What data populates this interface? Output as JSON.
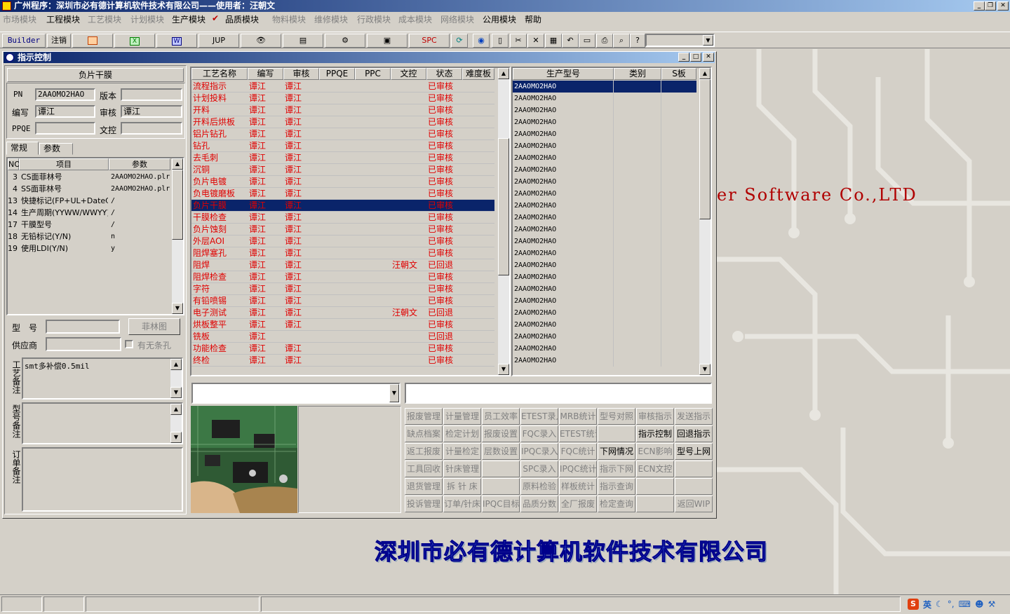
{
  "app": {
    "title": "广州程序：深圳市必有德计算机软件技术有限公司——使用者：汪朝文"
  },
  "menu": {
    "items": [
      {
        "label": "市场模块",
        "enabled": false
      },
      {
        "label": "工程模块",
        "enabled": true
      },
      {
        "label": "工艺模块",
        "enabled": false
      },
      {
        "label": "计划模块",
        "enabled": false
      },
      {
        "label": "生产模块",
        "enabled": true
      },
      {
        "label": "品质模块",
        "enabled": true
      },
      {
        "label": "物料模块",
        "enabled": false
      },
      {
        "label": "维修模块",
        "enabled": false
      },
      {
        "label": "行政模块",
        "enabled": false
      },
      {
        "label": "成本模块",
        "enabled": false
      },
      {
        "label": "网络模块",
        "enabled": false
      },
      {
        "label": "公用模块",
        "enabled": true
      },
      {
        "label": "帮助",
        "enabled": true
      }
    ]
  },
  "toolbar": {
    "builder": "Builder",
    "logout": "注销",
    "jup": "JUP",
    "spc": "SPC"
  },
  "window": {
    "title": "指示控制"
  },
  "form": {
    "section_title": "负片干膜",
    "pn_label": "PN",
    "pn_value": "2AAOMO2HAO",
    "version_label": "版本",
    "version_value": "",
    "author_label": "编写",
    "author_value": "谭江",
    "review_label": "审核",
    "review_value": "谭江",
    "ppqe_label": "PPQE",
    "ppqe_value": "",
    "doc_label": "文控",
    "doc_value": "",
    "tab_general": "常规",
    "tab_params": "参数",
    "param_headers": [
      "NO",
      "项目",
      "参数"
    ],
    "params": [
      {
        "no": "3",
        "item": "CS面菲林号",
        "val": "2AAOMO2HAO.plr"
      },
      {
        "no": "4",
        "item": "SS面菲林号",
        "val": "2AAOMO2HAO.plr"
      },
      {
        "no": "13",
        "item": "快捷标记(FP+UL+DateC",
        "val": "/"
      },
      {
        "no": "14",
        "item": "生产周期(YYWW/WWYY)",
        "val": "/"
      },
      {
        "no": "17",
        "item": "干膜型号",
        "val": "/"
      },
      {
        "no": "18",
        "item": "无铅标记(Y/N)",
        "val": "n"
      },
      {
        "no": "19",
        "item": "使用LDI(Y/N)",
        "val": "y"
      }
    ],
    "model_label": "型　号",
    "film_button": "菲林图",
    "supplier_label": "供应商",
    "no_slot_label": "有无条孔",
    "process_note_label": "工艺备注",
    "process_note_value": "smt多补偿0.5mil",
    "model_note_label": "型号备注",
    "order_note_label": "订单备注"
  },
  "process_table": {
    "headers": [
      "工艺名称",
      "编写",
      "审核",
      "PPQE",
      "PPC",
      "文控",
      "状态",
      "难度板"
    ],
    "rows": [
      {
        "name": "流程指示",
        "author": "谭江",
        "review": "谭江",
        "doc": "",
        "status": "已审核"
      },
      {
        "name": "计划投料",
        "author": "谭江",
        "review": "谭江",
        "doc": "",
        "status": "已审核"
      },
      {
        "name": "开料",
        "author": "谭江",
        "review": "谭江",
        "doc": "",
        "status": "已审核"
      },
      {
        "name": "开料后烘板",
        "author": "谭江",
        "review": "谭江",
        "doc": "",
        "status": "已审核"
      },
      {
        "name": "铝片钻孔",
        "author": "谭江",
        "review": "谭江",
        "doc": "",
        "status": "已审核"
      },
      {
        "name": "钻孔",
        "author": "谭江",
        "review": "谭江",
        "doc": "",
        "status": "已审核"
      },
      {
        "name": "去毛刺",
        "author": "谭江",
        "review": "谭江",
        "doc": "",
        "status": "已审核"
      },
      {
        "name": "沉铜",
        "author": "谭江",
        "review": "谭江",
        "doc": "",
        "status": "已审核"
      },
      {
        "name": "负片电镀",
        "author": "谭江",
        "review": "谭江",
        "doc": "",
        "status": "已审核"
      },
      {
        "name": "负电镀磨板",
        "author": "谭江",
        "review": "谭江",
        "doc": "",
        "status": "已审核"
      },
      {
        "name": "负片干膜",
        "author": "谭江",
        "review": "谭江",
        "doc": "",
        "status": "已审核",
        "selected": true
      },
      {
        "name": "干膜检查",
        "author": "谭江",
        "review": "谭江",
        "doc": "",
        "status": "已审核"
      },
      {
        "name": "负片蚀刻",
        "author": "谭江",
        "review": "谭江",
        "doc": "",
        "status": "已审核"
      },
      {
        "name": "外层AOI",
        "author": "谭江",
        "review": "谭江",
        "doc": "",
        "status": "已审核"
      },
      {
        "name": "阻焊塞孔",
        "author": "谭江",
        "review": "谭江",
        "doc": "",
        "status": "已审核"
      },
      {
        "name": "阻焊",
        "author": "谭江",
        "review": "谭江",
        "doc": "汪朝文",
        "status": "已回退"
      },
      {
        "name": "阻焊检查",
        "author": "谭江",
        "review": "谭江",
        "doc": "",
        "status": "已审核"
      },
      {
        "name": "字符",
        "author": "谭江",
        "review": "谭江",
        "doc": "",
        "status": "已审核"
      },
      {
        "name": "有铅喷锡",
        "author": "谭江",
        "review": "谭江",
        "doc": "",
        "status": "已审核"
      },
      {
        "name": "电子测试",
        "author": "谭江",
        "review": "谭江",
        "doc": "汪朝文",
        "status": "已回退"
      },
      {
        "name": "烘板整平",
        "author": "谭江",
        "review": "谭江",
        "doc": "",
        "status": "已审核"
      },
      {
        "name": "铣板",
        "author": "谭江",
        "review": "",
        "doc": "",
        "status": "已回退"
      },
      {
        "name": "功能检查",
        "author": "谭江",
        "review": "谭江",
        "doc": "",
        "status": "已审核"
      },
      {
        "name": "终检",
        "author": "谭江",
        "review": "谭江",
        "doc": "",
        "status": "已审核"
      }
    ]
  },
  "model_table": {
    "headers": [
      "生产型号",
      "类别",
      "S板"
    ],
    "value": "2AAOMO2HAO",
    "row_count": 24
  },
  "buttons": [
    [
      {
        "l": "报废管理",
        "e": false
      },
      {
        "l": "计量管理",
        "e": false
      },
      {
        "l": "员工效率",
        "e": false
      },
      {
        "l": "ETEST录入",
        "e": false
      },
      {
        "l": "MRB统计",
        "e": false
      },
      {
        "l": "型号对照",
        "e": false
      },
      {
        "l": "审核指示",
        "e": false
      },
      {
        "l": "发送指示",
        "e": false
      }
    ],
    [
      {
        "l": "缺点档案",
        "e": false
      },
      {
        "l": "检定计划",
        "e": false
      },
      {
        "l": "报废设置",
        "e": false
      },
      {
        "l": "FQC录入",
        "e": false
      },
      {
        "l": "ETEST统计",
        "e": false
      },
      {
        "l": "",
        "e": false
      },
      {
        "l": "指示控制",
        "e": true
      },
      {
        "l": "回退指示",
        "e": true
      }
    ],
    [
      {
        "l": "返工报废",
        "e": false
      },
      {
        "l": "计量检定",
        "e": false
      },
      {
        "l": "层数设置",
        "e": false
      },
      {
        "l": "IPQC录入",
        "e": false
      },
      {
        "l": "FQC统计",
        "e": false
      },
      {
        "l": "下网情况",
        "e": true
      },
      {
        "l": "ECN影响",
        "e": false
      },
      {
        "l": "型号上网",
        "e": true
      }
    ],
    [
      {
        "l": "工具回收",
        "e": false
      },
      {
        "l": "针床管理",
        "e": false
      },
      {
        "l": "",
        "e": false
      },
      {
        "l": "SPC录入",
        "e": false
      },
      {
        "l": "IPQC统计",
        "e": false
      },
      {
        "l": "指示下网",
        "e": false
      },
      {
        "l": "ECN文控",
        "e": false
      },
      {
        "l": "",
        "e": false
      }
    ],
    [
      {
        "l": "退货管理",
        "e": false
      },
      {
        "l": "拆 针 床",
        "e": false
      },
      {
        "l": "",
        "e": false
      },
      {
        "l": "原料检验",
        "e": false
      },
      {
        "l": "样板统计",
        "e": false
      },
      {
        "l": "指示查询",
        "e": false
      },
      {
        "l": "",
        "e": false
      },
      {
        "l": "",
        "e": false
      }
    ],
    [
      {
        "l": "投诉管理",
        "e": false
      },
      {
        "l": "订单/针床",
        "e": false
      },
      {
        "l": "IPQC目标",
        "e": false
      },
      {
        "l": "品质分数",
        "e": false
      },
      {
        "l": "全厂报废",
        "e": false
      },
      {
        "l": "检定查询",
        "e": false
      },
      {
        "l": "",
        "e": false
      },
      {
        "l": "返回WIP",
        "e": false
      }
    ]
  ],
  "background": {
    "company": "深圳市必有德计算机软件技术有限公司",
    "english": "er Software Co.,LTD"
  },
  "tray": {
    "lang": "英"
  },
  "colors": {
    "title_start": "#0a246a",
    "title_end": "#a6caf0",
    "accent_red": "#e00000",
    "selection": "#0a246a"
  }
}
